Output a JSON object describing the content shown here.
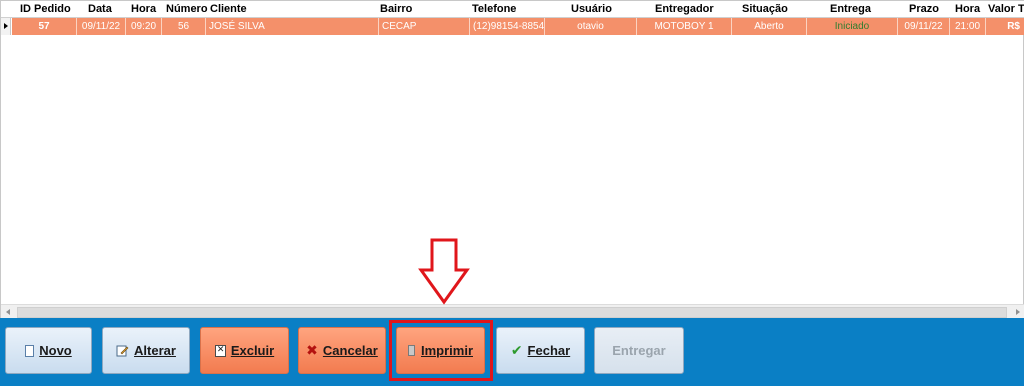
{
  "grid": {
    "columns": [
      "ID Pedido",
      "Data",
      "Hora",
      "Número",
      "Cliente",
      "Bairro",
      "Telefone",
      "Usuário",
      "Entregador",
      "Situação",
      "Entrega",
      "Prazo",
      "Hora",
      "Valor T"
    ],
    "rows": [
      {
        "id_pedido": "57",
        "data": "09/11/22",
        "hora": "09:20",
        "numero": "56",
        "cliente": "JOSÉ SILVA",
        "bairro": "CECAP",
        "telefone": "(12)98154-8854",
        "usuario": "otavio",
        "entregador": "MOTOBOY 1",
        "situacao": "Aberto",
        "entrega": "Iniciado",
        "prazo": "09/11/22",
        "hora_prazo": "21:00",
        "valor": "R$"
      }
    ]
  },
  "toolbar": {
    "novo": "Novo",
    "alterar": "Alterar",
    "excluir": "Excluir",
    "cancelar": "Cancelar",
    "imprimir": "Imprimir",
    "fechar": "Fechar",
    "entregar": "Entregar"
  },
  "colors": {
    "toolbar_bg": "#0a7fc5",
    "selected_row": "#f4906a",
    "highlight": "#e0161b",
    "entrega_status_text": "#2f7d2f"
  },
  "icons": {
    "novo": "document-icon",
    "alterar": "pencil-icon",
    "excluir": "delete-document-icon",
    "cancelar": "x-icon",
    "imprimir": "printer-icon",
    "fechar": "check-icon"
  }
}
